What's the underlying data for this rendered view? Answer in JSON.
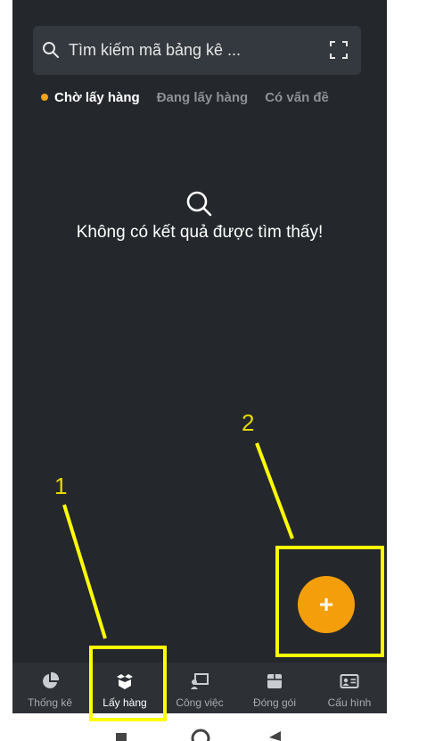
{
  "search": {
    "placeholder": "Tìm kiếm mã bảng kê ..."
  },
  "tabs": [
    {
      "label": "Chờ lấy hàng",
      "active": true
    },
    {
      "label": "Đang lấy hàng",
      "active": false
    },
    {
      "label": "Có vấn đề",
      "active": false
    }
  ],
  "empty_state": {
    "message": "Không có kết quả được tìm thấy!",
    "icon": "search-icon"
  },
  "fab": {
    "label": "+"
  },
  "bottom_nav": [
    {
      "label": "Thống kê",
      "icon": "pie-chart-icon"
    },
    {
      "label": "Lấy hàng",
      "icon": "open-box-icon",
      "active": true
    },
    {
      "label": "Công việc",
      "icon": "presentation-icon"
    },
    {
      "label": "Đóng gói",
      "icon": "package-icon"
    },
    {
      "label": "Cấu hình",
      "icon": "id-card-icon"
    }
  ],
  "annotations": [
    {
      "number": "1",
      "target": "bottom-nav-lay-hang"
    },
    {
      "number": "2",
      "target": "add-button"
    }
  ],
  "colors": {
    "background": "#24282c",
    "accent": "#f59e0b",
    "annotation": "#ffff00"
  }
}
